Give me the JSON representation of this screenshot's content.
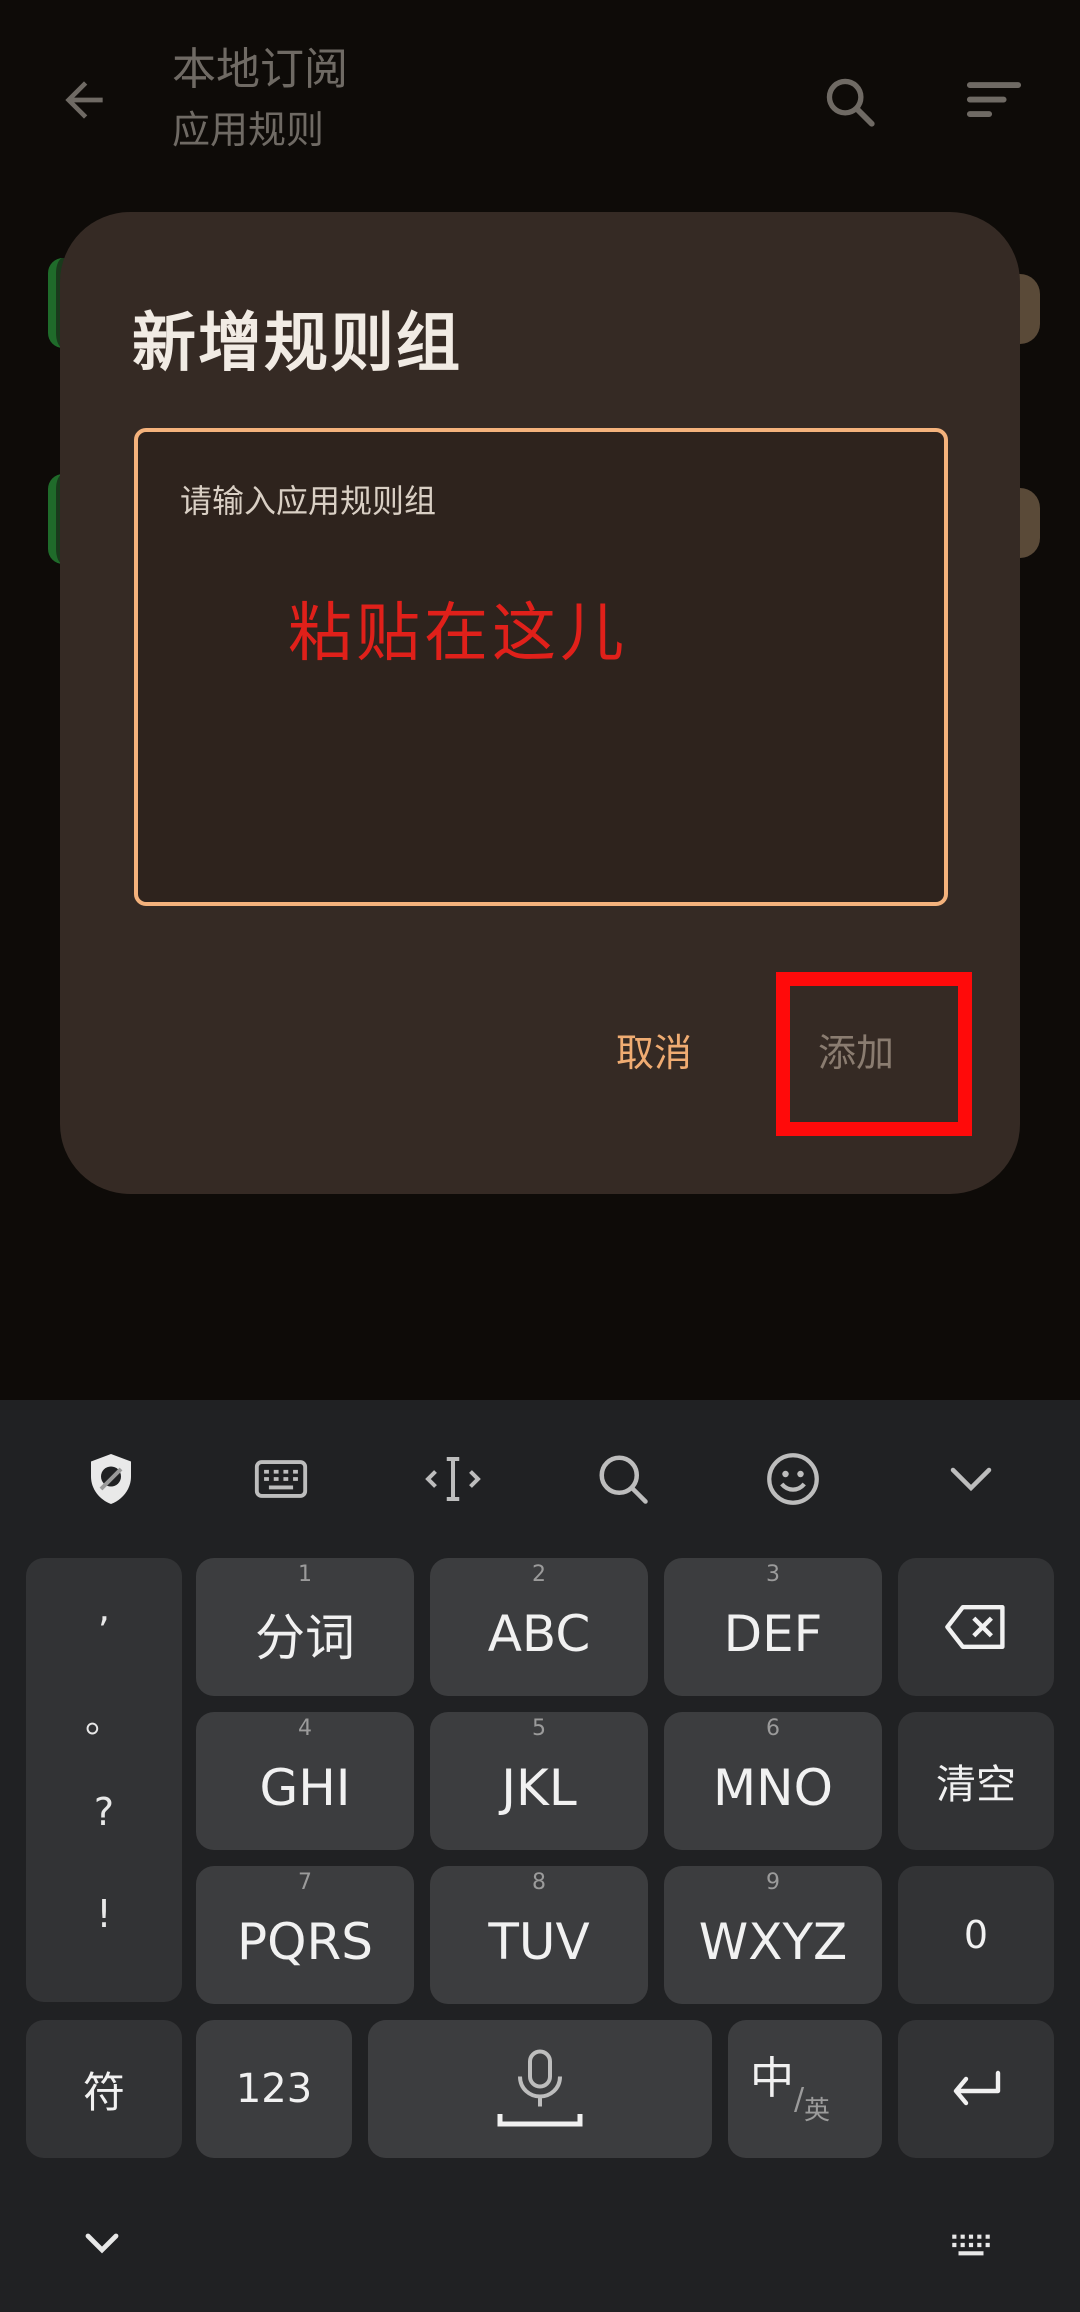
{
  "app_bar": {
    "title": "本地订阅",
    "subtitle": "应用规则"
  },
  "dialog": {
    "title": "新增规则组",
    "input_placeholder": "请输入应用规则组",
    "annotation": "粘贴在这儿",
    "cancel_label": "取消",
    "add_label": "添加"
  },
  "keyboard": {
    "toolbar_icons": [
      "shield-icon",
      "keyboard-icon",
      "cursor-icon",
      "search-icon",
      "emoji-icon",
      "chevron-down-icon"
    ],
    "punctuation": [
      ",",
      "。",
      "?",
      "!"
    ],
    "keys": {
      "k1": {
        "num": "1",
        "label": "分词"
      },
      "k2": {
        "num": "2",
        "label": "ABC"
      },
      "k3": {
        "num": "3",
        "label": "DEF"
      },
      "k4": {
        "num": "4",
        "label": "GHI"
      },
      "k5": {
        "num": "5",
        "label": "JKL"
      },
      "k6": {
        "num": "6",
        "label": "MNO"
      },
      "k7": {
        "num": "7",
        "label": "PQRS"
      },
      "k8": {
        "num": "8",
        "label": "TUV"
      },
      "k9": {
        "num": "9",
        "label": "WXYZ"
      },
      "clear": "清空",
      "zero": "0",
      "symbols": "符",
      "numbers": "123",
      "lang_main": "中",
      "lang_sub": "英"
    }
  },
  "colors": {
    "dialog_bg": "#352a24",
    "accent": "#f0ac72",
    "annotation_red": "#e0201a",
    "highlight_red": "#ff0a0a"
  }
}
